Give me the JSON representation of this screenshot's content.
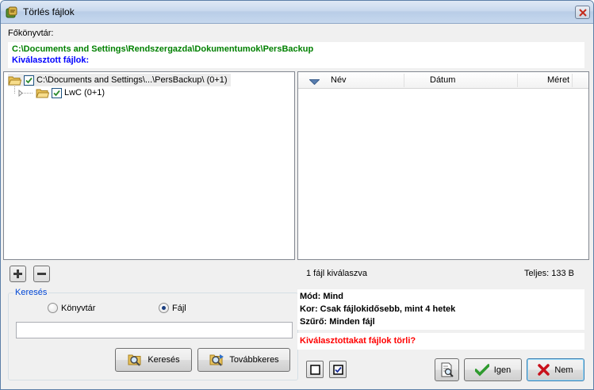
{
  "window": {
    "title": "Törlés fájlok"
  },
  "root": {
    "label": "Főkönyvtár:",
    "path": "C:\\Documents and Settings\\Rendszergazda\\Dokumentumok\\PersBackup",
    "selected_label": "Kiválasztott fájlok:"
  },
  "tree": {
    "items": [
      {
        "label": "C:\\Documents and Settings\\...\\PersBackup\\ (0+1)",
        "checked": true
      },
      {
        "label": "LwC (0+1)",
        "checked": true
      }
    ]
  },
  "file_list": {
    "columns": [
      "Név",
      "Dátum",
      "Méret"
    ],
    "rows": []
  },
  "status": {
    "selected_count": "1 fájl kiválaszva",
    "total": "Teljes: 133 B"
  },
  "search": {
    "group_title": "Keresés",
    "radio_folder": "Könyvtár",
    "radio_file": "Fájl",
    "selected_option": "Fájl",
    "input_value": "",
    "search_button": "Keresés",
    "next_button": "Továbbkeres"
  },
  "info": {
    "mode": "Mód: Mind",
    "age": "Kor: Csak fájlokidősebb, mint  4 hetek",
    "filter": "Szűrő: Minden fájl",
    "warning": "Kiválasztottakat fájlok törli?"
  },
  "buttons": {
    "yes": "Igen",
    "no": "Nem"
  },
  "colors": {
    "path_green": "#008000",
    "selected_blue": "#0000ff",
    "warning_red": "#ff0000"
  }
}
